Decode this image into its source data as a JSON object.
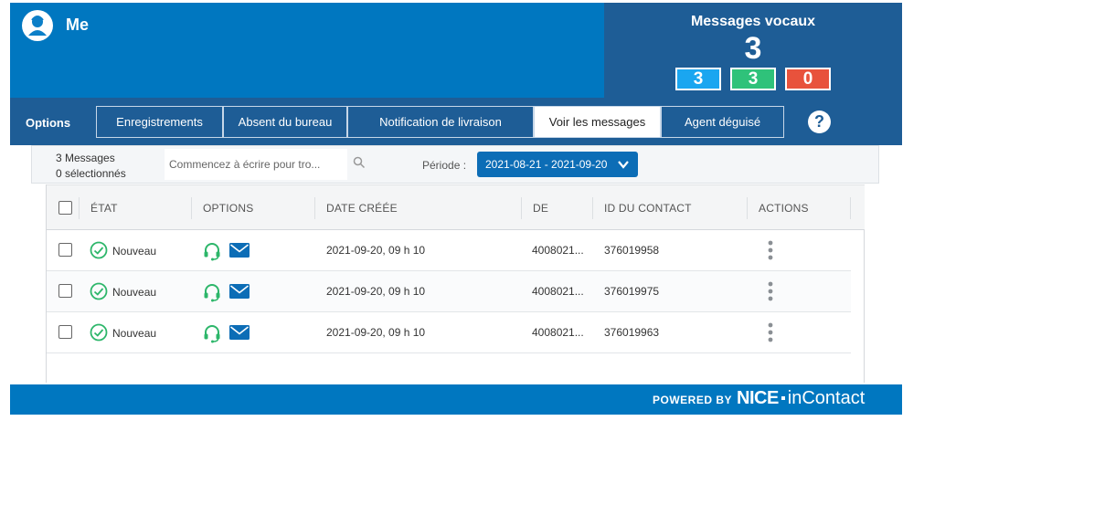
{
  "header": {
    "user_name": "Me",
    "voicemail_title": "Messages vocaux",
    "voicemail_total": "3",
    "counters": [
      {
        "value": "3",
        "color": "#1aa6f0"
      },
      {
        "value": "3",
        "color": "#2fc27a"
      },
      {
        "value": "0",
        "color": "#e8523c"
      }
    ]
  },
  "nav": {
    "options_label": "Options",
    "tabs": [
      {
        "label": "Enregistrements"
      },
      {
        "label": "Absent du bureau"
      },
      {
        "label": "Notification de livraison"
      },
      {
        "label": "Voir les messages"
      },
      {
        "label": "Agent déguisé"
      }
    ],
    "active_tab": "Voir les messages",
    "help_label": "?"
  },
  "filter": {
    "messages_count": "3 Messages",
    "selected_count": "0 sélectionnés",
    "search_placeholder": "Commencez à écrire pour tro...",
    "period_label": "Période :",
    "date_range": "2021-08-21 - 2021-09-20"
  },
  "table": {
    "columns": [
      "ÉTAT",
      "OPTIONS",
      "DATE CRÉÉE",
      "DE",
      "ID DU CONTACT",
      "ACTIONS"
    ],
    "rows": [
      {
        "status": "Nouveau",
        "date": "2021-09-20, 09 h 10",
        "from": "4008021...",
        "contact_id": "376019958"
      },
      {
        "status": "Nouveau",
        "date": "2021-09-20, 09 h 10",
        "from": "4008021...",
        "contact_id": "376019975"
      },
      {
        "status": "Nouveau",
        "date": "2021-09-20, 09 h 10",
        "from": "4008021...",
        "contact_id": "376019963"
      }
    ]
  },
  "footer": {
    "powered_by": "POWERED BY",
    "brand_bold": "NICE",
    "brand_light": "inContact"
  },
  "colors": {
    "primary_blue": "#0077c0",
    "dark_blue": "#1e5d96",
    "status_green": "#2db66a",
    "mail_blue": "#0c6db6"
  }
}
